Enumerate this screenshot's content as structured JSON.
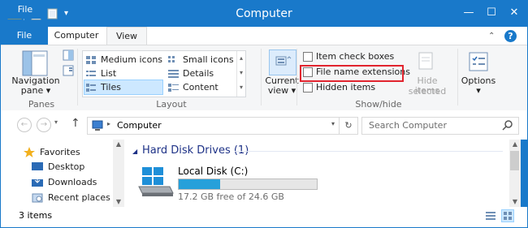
{
  "window": {
    "title": "Computer",
    "controls": {
      "minimize": "—",
      "maximize": "☐",
      "close": "✕"
    }
  },
  "ribbon_tabs": [
    {
      "label": "File"
    },
    {
      "label": "Computer"
    },
    {
      "label": "View"
    }
  ],
  "ribbon": {
    "panes": {
      "nav_pane_label_1": "Navigation",
      "nav_pane_label_2": "pane",
      "group_label": "Panes"
    },
    "layout": {
      "group_label": "Layout",
      "items": [
        {
          "label": "Medium icons"
        },
        {
          "label": "Small icons"
        },
        {
          "label": "List"
        },
        {
          "label": "Details"
        },
        {
          "label": "Tiles"
        },
        {
          "label": "Content"
        }
      ]
    },
    "current_view": {
      "label_1": "Current",
      "label_2": "view"
    },
    "show_hide": {
      "group_label": "Show/hide",
      "checkboxes": [
        {
          "label": "Item check boxes",
          "checked": false
        },
        {
          "label": "File name extensions",
          "checked": false
        },
        {
          "label": "Hidden items",
          "checked": false
        }
      ],
      "hide_selected_1": "Hide selected",
      "hide_selected_2": "items"
    },
    "options": {
      "label": "Options"
    }
  },
  "address": {
    "path": "Computer",
    "search_placeholder": "Search Computer"
  },
  "nav_pane": {
    "items": [
      {
        "label": "Favorites"
      },
      {
        "label": "Desktop"
      },
      {
        "label": "Downloads"
      },
      {
        "label": "Recent places"
      }
    ]
  },
  "content": {
    "group_header": "Hard Disk Drives (1)",
    "drive": {
      "name": "Local Disk (C:)",
      "free_text": "17.2 GB free of 24.6 GB",
      "used_fraction": 0.3
    }
  },
  "status": {
    "item_count": "3 items"
  },
  "colors": {
    "accent": "#1979ca",
    "highlight_border": "#e1242e",
    "progress_fill": "#26a0da",
    "header_blue": "#1e3287"
  }
}
